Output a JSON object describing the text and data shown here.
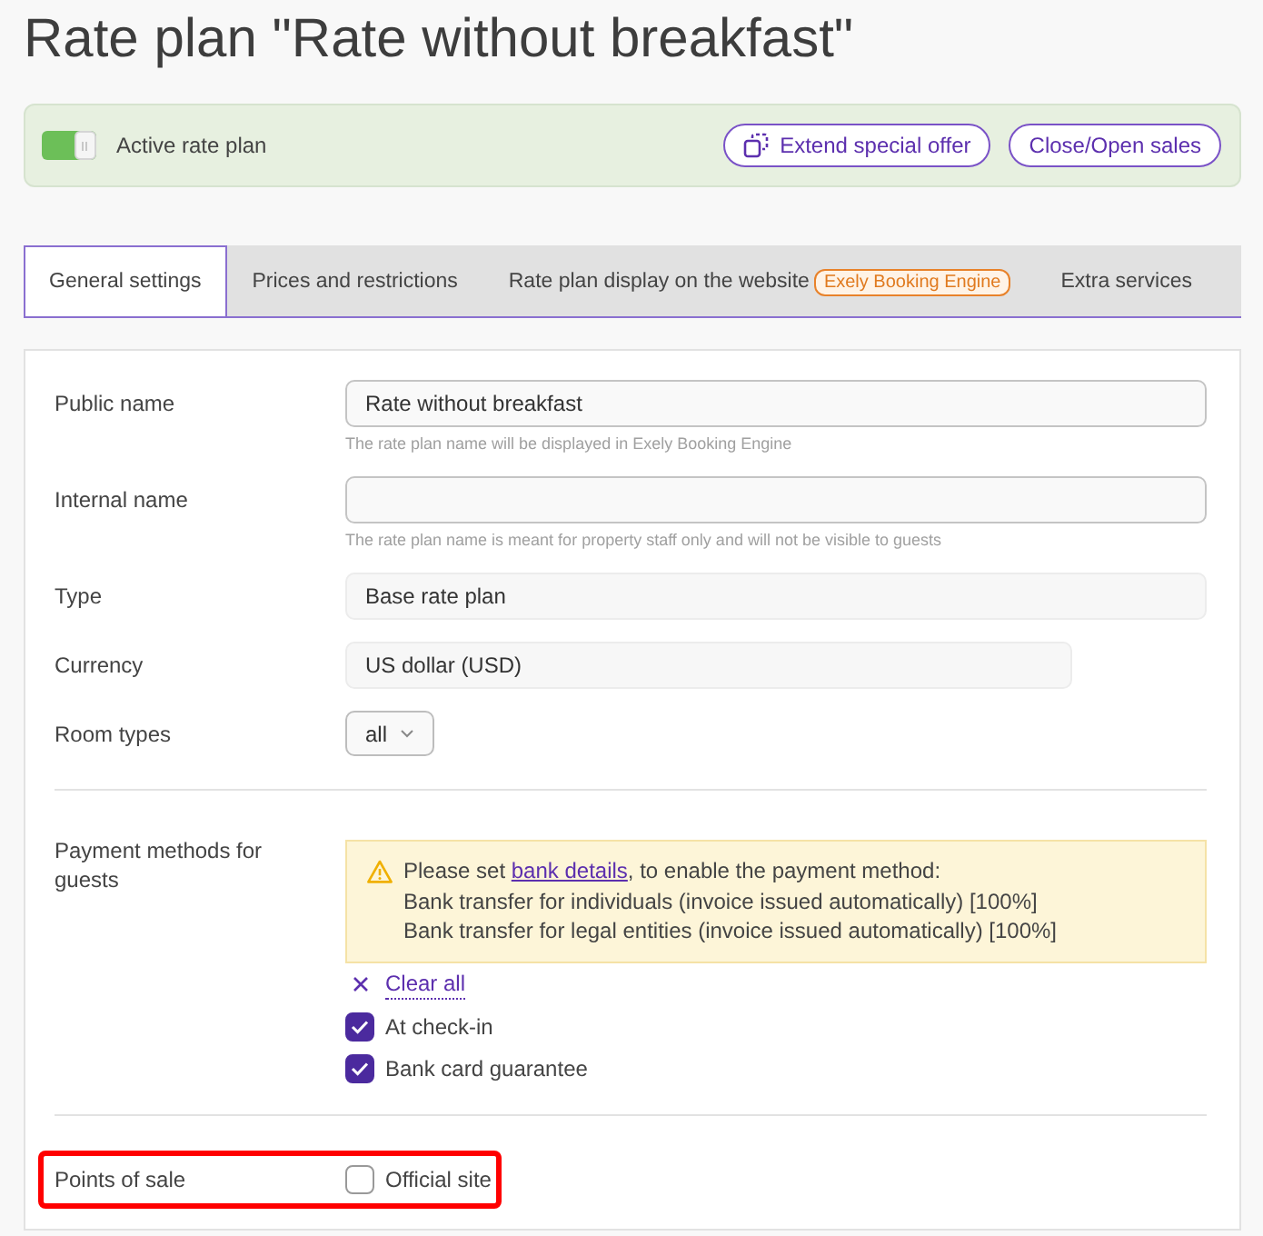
{
  "page_title": "Rate plan \"Rate without breakfast\"",
  "status_panel": {
    "toggle": {
      "label": "Active rate plan",
      "on": true
    },
    "buttons": [
      {
        "label": "Extend special offer",
        "kind": "with_icon"
      },
      {
        "label": "Close/Open sales",
        "kind": "plain"
      }
    ]
  },
  "tabs": [
    {
      "label": "General settings",
      "selected": true
    },
    {
      "label": "Prices and restrictions",
      "selected": false
    },
    {
      "label": "Rate plan display on the website",
      "badge": "Exely Booking Engine",
      "selected": false
    },
    {
      "label": "Extra services",
      "selected": false
    }
  ],
  "form": {
    "sections": [
      {
        "rows": [
          {
            "kind": "input",
            "label": "Public name",
            "value": "Rate without breakfast",
            "hint": "The rate plan name will be displayed in Exely Booking Engine"
          },
          {
            "kind": "input",
            "label": "Internal name",
            "hint": "The rate plan name is meant for property staff only and will not be visible to guests"
          },
          {
            "kind": "static_wide",
            "label": "Type",
            "value": "Base rate plan"
          },
          {
            "kind": "static_short",
            "label": "Currency",
            "value": "US dollar (USD)"
          },
          {
            "kind": "dropdown",
            "label": "Room types",
            "value": "all"
          }
        ]
      },
      {
        "rows": [
          {
            "kind": "checkboxes",
            "label": "Payment methods for guests",
            "warning": {
              "before": "Please set ",
              "link": "bank details",
              "after": ", to enable the payment method:",
              "items": [
                "Bank transfer for individuals (invoice issued automatically) [100%]",
                "Bank transfer for legal entities (invoice issued automatically) [100%]"
              ]
            },
            "clear_all": "Clear all",
            "options": [
              {
                "label": "At check-in",
                "checked": true
              },
              {
                "label": "Bank card guarantee",
                "checked": true
              }
            ]
          }
        ]
      },
      {
        "rows": [
          {
            "kind": "checkboxes",
            "label": "Points of sale",
            "highlighted": true,
            "options": [
              {
                "label": "Official site",
                "checked": false
              }
            ]
          }
        ]
      }
    ]
  }
}
